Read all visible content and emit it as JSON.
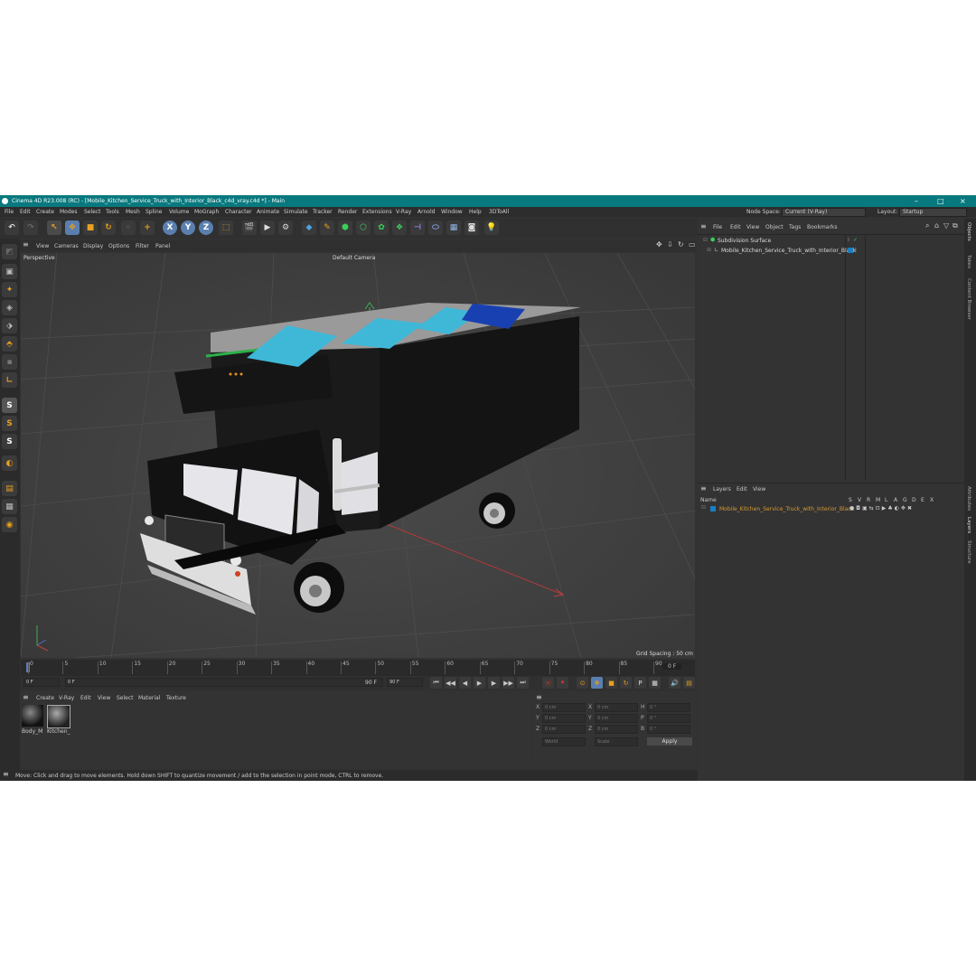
{
  "window": {
    "title": "Cinema 4D R23.008 (RC) - [Mobile_Kitchen_Service_Truck_with_Interior_Black_c4d_vray.c4d *] - Main"
  },
  "menu": {
    "items": [
      "File",
      "Edit",
      "Create",
      "Modes",
      "Select",
      "Tools",
      "Mesh",
      "Spline",
      "Volume",
      "MoGraph",
      "Character",
      "Animate",
      "Simulate",
      "Tracker",
      "Render",
      "Extensions",
      "V-Ray",
      "Arnold",
      "Window",
      "Help",
      "3DToAll"
    ],
    "node_space_label": "Node Space:",
    "node_space_value": "Current (V-Ray)",
    "layout_label": "Layout:",
    "layout_value": "Startup"
  },
  "toolbar": {
    "axis_x": "X",
    "axis_y": "Y",
    "axis_z": "Z"
  },
  "viewport": {
    "menu": [
      "View",
      "Cameras",
      "Display",
      "Options",
      "Filter",
      "Panel"
    ],
    "label": "Perspective",
    "camera": "Default Camera",
    "grid_spacing": "Grid Spacing : 50 cm"
  },
  "timeline": {
    "ticks": [
      "0",
      "5",
      "10",
      "15",
      "20",
      "25",
      "30",
      "35",
      "40",
      "45",
      "50",
      "55",
      "60",
      "65",
      "70",
      "75",
      "80",
      "85",
      "90"
    ],
    "current_frame": "0 F",
    "start": "0 F",
    "start2": "0 F",
    "end": "90 F",
    "end2": "90 F"
  },
  "material_manager": {
    "menu": [
      "Create",
      "V-Ray",
      "Edit",
      "View",
      "Select",
      "Material",
      "Texture"
    ],
    "materials": [
      "Body_M",
      "Kitchen_"
    ]
  },
  "coordinates": {
    "rows": [
      {
        "a": "X",
        "av": "0 cm",
        "b": "X",
        "bv": "0 cm",
        "c": "H",
        "cv": "0 °"
      },
      {
        "a": "Y",
        "av": "0 cm",
        "b": "Y",
        "bv": "0 cm",
        "c": "P",
        "cv": "0 °"
      },
      {
        "a": "Z",
        "av": "0 cm",
        "b": "Z",
        "bv": "0 cm",
        "c": "B",
        "cv": "0 °"
      }
    ],
    "mode1": "World",
    "mode2": "Scale",
    "apply": "Apply"
  },
  "object_manager": {
    "menu": [
      "File",
      "Edit",
      "View",
      "Object",
      "Tags",
      "Bookmarks"
    ],
    "objects": [
      "Subdivision Surface",
      "Mobile_Kitchen_Service_Truck_with_Interior_Black"
    ]
  },
  "layer_manager": {
    "menu": [
      "Layers",
      "Edit",
      "View"
    ],
    "name_header": "Name",
    "columns": [
      "S",
      "V",
      "R",
      "M",
      "L",
      "A",
      "G",
      "D",
      "E",
      "X"
    ],
    "layers": [
      "Mobile_Kitchen_Service_Truck_with_Interior_Black"
    ]
  },
  "side_tabs": [
    "Objects",
    "Takes",
    "Content Browser",
    "Attributes",
    "Layers",
    "Structure"
  ],
  "status": "Move: Click and drag to move elements. Hold down SHIFT to quantize movement / add to the selection in point mode, CTRL to remove.",
  "colors": {
    "title_bar": "#08797f",
    "accent_orange": "#e8a020",
    "layer_text": "#d89a30",
    "viewport_bg": "#3d3d3d",
    "panel_roof": "#3fb8d8"
  }
}
